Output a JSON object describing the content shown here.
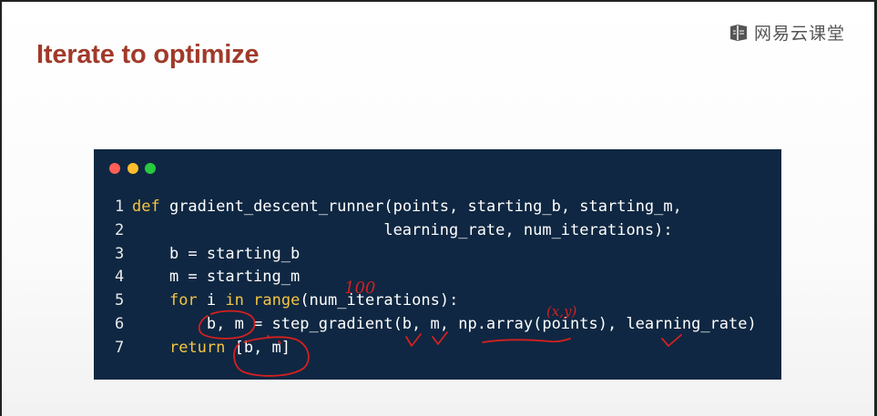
{
  "slide": {
    "title": "Iterate to optimize",
    "brand": "网易云课堂",
    "title_color": "#a03a2a",
    "code_background": "#0f2742"
  },
  "window_controls": [
    "close-dot",
    "minimize-dot",
    "maximize-dot"
  ],
  "code": {
    "keyword_color": "#f5c542",
    "lines": [
      {
        "num": "1",
        "parts": [
          {
            "kw": "def"
          },
          {
            "t": " gradient_descent_runner(points, starting_b, starting_m,"
          }
        ]
      },
      {
        "num": "2",
        "parts": [
          {
            "t": "                           learning_rate, num_iterations):"
          }
        ]
      },
      {
        "num": "3",
        "parts": [
          {
            "t": "    b = starting_b"
          }
        ]
      },
      {
        "num": "4",
        "parts": [
          {
            "t": "    m = starting_m"
          }
        ]
      },
      {
        "num": "5",
        "parts": [
          {
            "t": "    "
          },
          {
            "kw": "for"
          },
          {
            "t": " i "
          },
          {
            "kw": "in"
          },
          {
            "t": " "
          },
          {
            "kw": "range"
          },
          {
            "t": "(num_iterations):"
          }
        ]
      },
      {
        "num": "6",
        "parts": [
          {
            "t": "        b, m = step_gradient(b, m, np.array(points), learning_rate)"
          }
        ]
      },
      {
        "num": "7",
        "parts": [
          {
            "t": "    "
          },
          {
            "kw": "return"
          },
          {
            "t": " [b, m]"
          }
        ]
      }
    ]
  },
  "annotations": {
    "ink_color": "#d42020",
    "note_100": "100",
    "note_xy": "(x,y)"
  }
}
